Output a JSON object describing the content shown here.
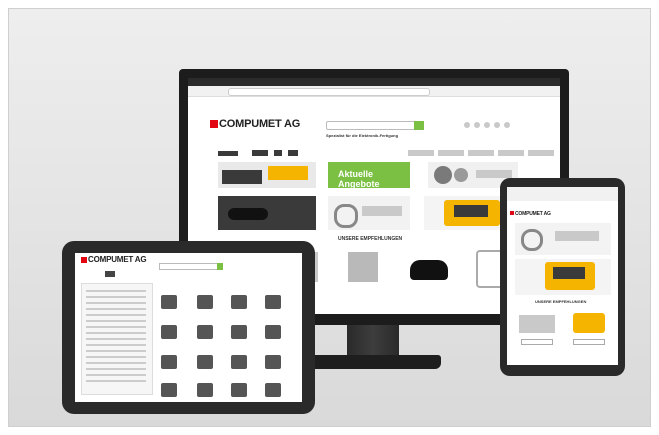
{
  "brand": {
    "name": "COMPUMET AG",
    "accent": "#e30613",
    "green": "#7bc043",
    "yellow": "#f5b400"
  },
  "monitor": {
    "logo": "COMPUMET AG",
    "tagline": "Spezialist für die Elektronik-Fertigung",
    "promo": "Aktuelle Angebote",
    "section_title": "UNSERE EMPFEHLUNGEN"
  },
  "tablet": {
    "logo": "COMPUMET AG"
  },
  "phone": {
    "logo": "COMPUMET AG",
    "section_title": "UNSERE EMPFEHLUNGEN"
  }
}
